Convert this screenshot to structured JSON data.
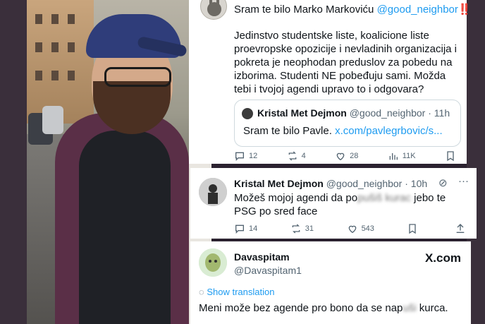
{
  "tweet1": {
    "header_text": "Sram te bilo Marko Markoviću ",
    "header_mention": "@good_neighbor",
    "header_marks": "‼️",
    "body": "Jedinstvo studentske liste, koalicione liste proevropske opozicije i nevladinih organizacija i pokreta je neophodan preduslov za pobedu na izborima. Studenti NE pobeđuju sami. Možda tebi i tvojoj agendi upravo to i odgovara?",
    "quote": {
      "name": "Kristal Met Dejmon",
      "handle": "@good_neighbor",
      "time": "· 11h",
      "text": "Sram te bilo Pavle. ",
      "link": "x.com/pavlegrbovic/s..."
    },
    "stats": {
      "replies": "12",
      "reposts": "4",
      "likes": "28",
      "views": "11K"
    }
  },
  "tweet2": {
    "name": "Kristal Met Dejmon",
    "handle": "@good_neighbor",
    "time": "· 10h",
    "text_before": "Možeš mojoj agendi da po",
    "text_blur1": "pušiš",
    "text_mid": " ",
    "text_blur2": "kurac",
    "text_after": " jebo te",
    "line2": "PSG po sred face",
    "stats": {
      "replies": "14",
      "reposts": "31",
      "likes": "543"
    }
  },
  "tweet3": {
    "name": "Davaspitam",
    "handle": "@Davaspitam1",
    "brand": "X.com",
    "show_translation": "Show translation",
    "text_before": "Meni može bez agende pro bono da se nap",
    "text_blur": "uši",
    "text_after": " kurca."
  },
  "colors": {
    "accent": "#1d9bf0",
    "muted": "#536471",
    "text": "#0f1419"
  }
}
